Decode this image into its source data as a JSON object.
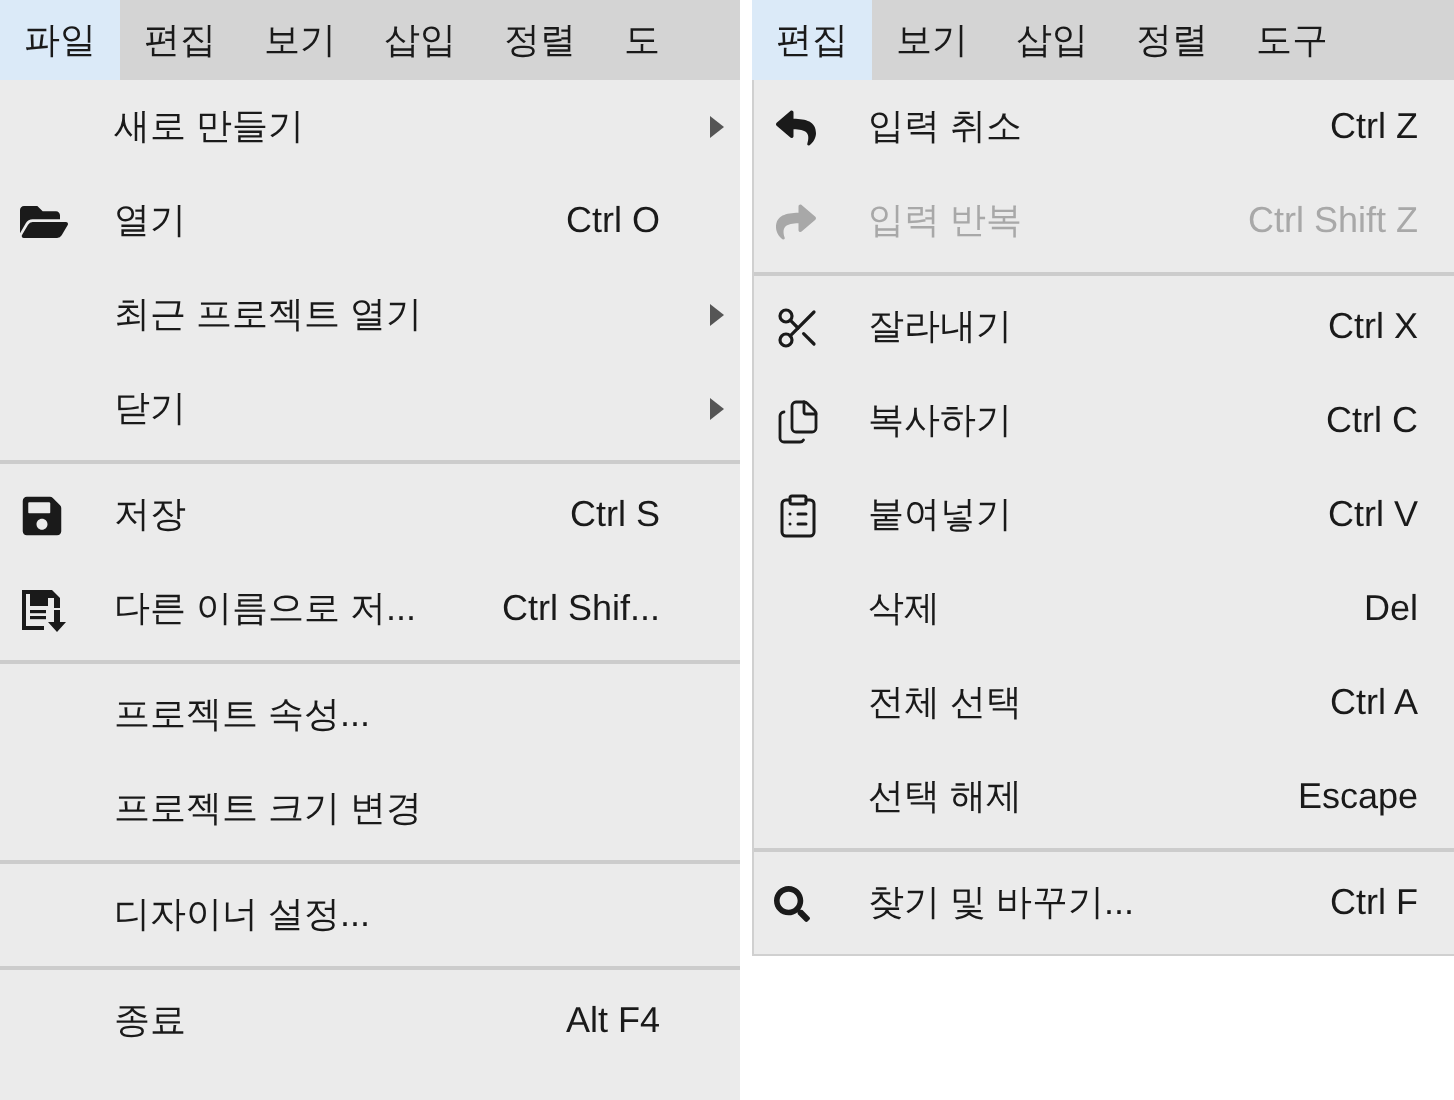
{
  "panels": [
    {
      "menu_bar": [
        {
          "label": "파일",
          "selected": true
        },
        {
          "label": "편집",
          "selected": false
        },
        {
          "label": "보기",
          "selected": false
        },
        {
          "label": "삽입",
          "selected": false
        },
        {
          "label": "정렬",
          "selected": false
        },
        {
          "label": "도",
          "selected": false
        }
      ],
      "items": [
        {
          "kind": "item",
          "label": "새로 만들기",
          "submenu": true,
          "disabled": false
        },
        {
          "kind": "item",
          "label": "열기",
          "shortcut": "Ctrl O",
          "submenu": false,
          "disabled": false
        },
        {
          "kind": "item",
          "label": "최근 프로젝트 열기",
          "submenu": true,
          "disabled": false
        },
        {
          "kind": "item",
          "label": "닫기",
          "submenu": true,
          "disabled": false
        },
        {
          "kind": "separator"
        },
        {
          "kind": "item",
          "label": "저장",
          "shortcut": "Ctrl S",
          "submenu": false,
          "disabled": false
        },
        {
          "kind": "item",
          "label": "다른 이름으로 저...",
          "shortcut": "Ctrl Shif...",
          "submenu": false,
          "disabled": false
        },
        {
          "kind": "separator"
        },
        {
          "kind": "item",
          "label": "프로젝트 속성...",
          "submenu": false,
          "disabled": false
        },
        {
          "kind": "item",
          "label": "프로젝트 크기 변경",
          "submenu": false,
          "disabled": false
        },
        {
          "kind": "separator"
        },
        {
          "kind": "item",
          "label": "디자이너 설정...",
          "submenu": false,
          "disabled": false
        },
        {
          "kind": "separator"
        },
        {
          "kind": "item",
          "label": "종료",
          "shortcut": "Alt F4",
          "submenu": false,
          "disabled": false
        }
      ]
    },
    {
      "menu_bar": [
        {
          "label": "편집",
          "selected": true
        },
        {
          "label": "보기",
          "selected": false
        },
        {
          "label": "삽입",
          "selected": false
        },
        {
          "label": "정렬",
          "selected": false
        },
        {
          "label": "도구",
          "selected": false
        }
      ],
      "items": [
        {
          "kind": "item",
          "label": "입력 취소",
          "shortcut": "Ctrl Z",
          "disabled": false
        },
        {
          "kind": "item",
          "label": "입력 반복",
          "shortcut": "Ctrl Shift Z",
          "disabled": true
        },
        {
          "kind": "separator"
        },
        {
          "kind": "item",
          "label": "잘라내기",
          "shortcut": "Ctrl X",
          "disabled": false
        },
        {
          "kind": "item",
          "label": "복사하기",
          "shortcut": "Ctrl C",
          "disabled": false
        },
        {
          "kind": "item",
          "label": "붙여넣기",
          "shortcut": "Ctrl V",
          "disabled": false
        },
        {
          "kind": "item",
          "label": "삭제",
          "shortcut": "Del",
          "disabled": false
        },
        {
          "kind": "item",
          "label": "전체 선택",
          "shortcut": "Ctrl A",
          "disabled": false
        },
        {
          "kind": "item",
          "label": "선택 해제",
          "shortcut": "Escape",
          "disabled": false
        },
        {
          "kind": "separator"
        },
        {
          "kind": "item",
          "label": "찾기 및 바꾸기...",
          "shortcut": "Ctrl F",
          "disabled": false
        }
      ]
    }
  ]
}
